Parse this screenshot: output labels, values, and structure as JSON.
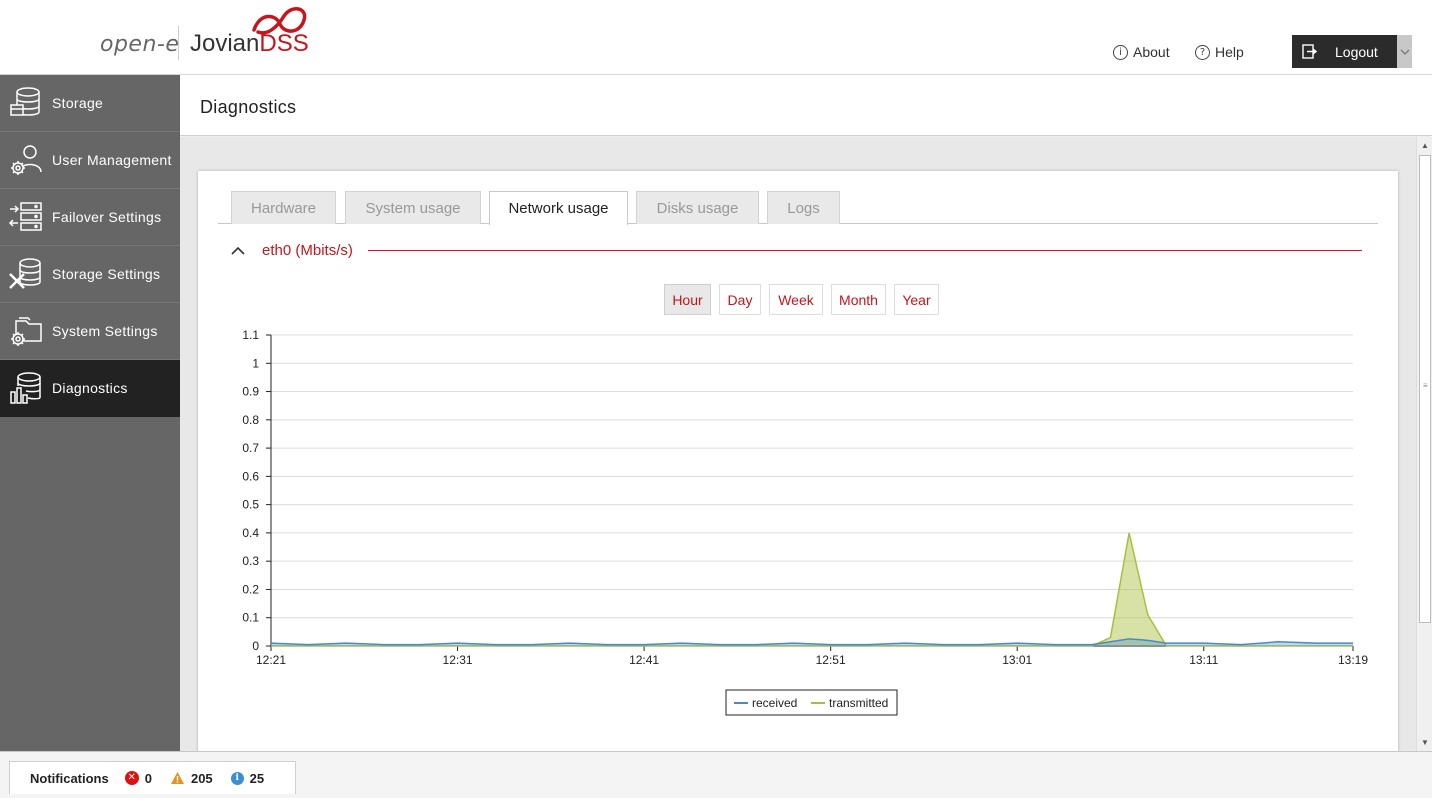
{
  "header": {
    "logo_left": "open-e",
    "logo_brand": "Jovian",
    "logo_brand_suffix": "DSS",
    "about_label": "About",
    "help_label": "Help",
    "logout_label": "Logout"
  },
  "sidebar": {
    "items": [
      {
        "label": "Storage",
        "icon": "storage-icon"
      },
      {
        "label": "User Management",
        "icon": "user-gear-icon"
      },
      {
        "label": "Failover Settings",
        "icon": "failover-icon"
      },
      {
        "label": "Storage Settings",
        "icon": "storage-tools-icon"
      },
      {
        "label": "System Settings",
        "icon": "folder-gear-icon"
      },
      {
        "label": "Diagnostics",
        "icon": "diagnostics-icon",
        "active": true
      }
    ]
  },
  "page": {
    "title": "Diagnostics"
  },
  "tabs": [
    {
      "label": "Hardware",
      "active": false
    },
    {
      "label": "System usage",
      "active": false
    },
    {
      "label": "Network usage",
      "active": true
    },
    {
      "label": "Disks usage",
      "active": false
    },
    {
      "label": "Logs",
      "active": false
    }
  ],
  "section": {
    "title": "eth0 (Mbits/s)"
  },
  "ranges": [
    {
      "label": "Hour",
      "active": true
    },
    {
      "label": "Day",
      "active": false
    },
    {
      "label": "Week",
      "active": false
    },
    {
      "label": "Month",
      "active": false
    },
    {
      "label": "Year",
      "active": false
    }
  ],
  "chart_data": {
    "type": "area",
    "title": "",
    "xlabel": "",
    "ylabel": "",
    "ylim": [
      0,
      1.1
    ],
    "yticks": [
      "1.1",
      "1",
      "0.9",
      "0.8",
      "0.7",
      "0.6",
      "0.5",
      "0.4",
      "0.3",
      "0.2",
      "0.1",
      "0"
    ],
    "xticks": [
      "12:21",
      "12:31",
      "12:41",
      "12:51",
      "13:01",
      "13:11",
      "13:19"
    ],
    "grid": true,
    "legend_position": "bottom-center",
    "x_minutes": [
      0,
      2,
      4,
      6,
      8,
      10,
      12,
      14,
      16,
      18,
      20,
      22,
      24,
      26,
      28,
      30,
      32,
      34,
      36,
      38,
      40,
      42,
      44,
      45,
      46,
      47,
      48,
      50,
      52,
      54,
      56,
      58
    ],
    "series": [
      {
        "name": "received",
        "color": "#4a8ac8",
        "values": [
          0.01,
          0.005,
          0.01,
          0.005,
          0.005,
          0.01,
          0.005,
          0.005,
          0.01,
          0.005,
          0.005,
          0.01,
          0.005,
          0.005,
          0.01,
          0.005,
          0.005,
          0.01,
          0.005,
          0.005,
          0.01,
          0.005,
          0.005,
          0.015,
          0.025,
          0.02,
          0.01,
          0.01,
          0.005,
          0.015,
          0.01,
          0.01
        ]
      },
      {
        "name": "transmitted",
        "color": "#a9bf3c",
        "values": [
          0.0,
          0.0,
          0.0,
          0.0,
          0.0,
          0.0,
          0.0,
          0.0,
          0.0,
          0.0,
          0.0,
          0.0,
          0.0,
          0.0,
          0.0,
          0.0,
          0.0,
          0.0,
          0.0,
          0.0,
          0.0,
          0.0,
          0.0,
          0.03,
          0.4,
          0.11,
          0.0,
          0.0,
          0.0,
          0.0,
          0.0,
          0.0
        ]
      }
    ]
  },
  "notifications": {
    "label": "Notifications",
    "errors": "0",
    "warnings": "205",
    "info": "25"
  }
}
